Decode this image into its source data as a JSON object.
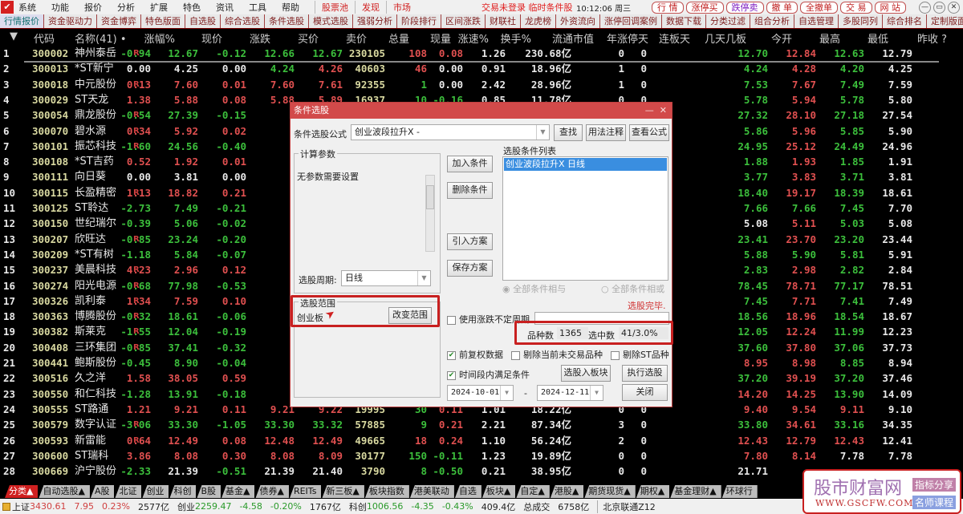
{
  "menu": {
    "items": [
      "系统",
      "功能",
      "报价",
      "分析",
      "扩展",
      "特色",
      "资讯",
      "工具",
      "帮助"
    ],
    "special": [
      "股票池",
      "发现",
      "市场"
    ],
    "status": "交易未登录  临时条件股",
    "clock": "10:12:06 周三",
    "buttons": [
      "行 情",
      "涨停买",
      "跌停卖",
      "撤 单",
      "全撤单",
      "交 易",
      "网 站"
    ],
    "window": [
      "—",
      "▭",
      "✕"
    ]
  },
  "tabs": [
    "行情报价",
    "资金驱动力",
    "资金博弈",
    "特色版面",
    "自选股",
    "综合选股",
    "条件选股",
    "模式选股",
    "强弱分析",
    "阶段排行",
    "区间涨跌",
    "财联社",
    "龙虎榜",
    "外资流向",
    "涨停回调案例",
    "数据下载",
    "分类过滤",
    "组合分析",
    "自选管理",
    "多股同列",
    "综合排名",
    "定制版面"
  ],
  "header": [
    "▼",
    "代码",
    "名称(41)  •",
    "涨幅%",
    "现价",
    "涨跌",
    "买价",
    "卖价",
    "总量",
    "现量",
    "涨速%",
    "换手%",
    "流通市值",
    "年涨停天",
    "连板天",
    "几天几板",
    "今开",
    "最高",
    "最低",
    "昨收 ?"
  ],
  "colors": {
    "up": "#e05050",
    "down": "#3cbf3c",
    "flat": "#e8e8e8",
    "volume": "#d8d8a0"
  },
  "rows": [
    [
      "1",
      "300002",
      "神州泰岳",
      "R",
      "-0.94",
      "12.67",
      "-0.12",
      "12.66",
      "12.67",
      "230105",
      "108",
      "0.08",
      "1.26",
      "230.68亿",
      "0",
      "0",
      "",
      "12.70",
      "12.84",
      "12.63",
      "12.79",
      "up"
    ],
    [
      "2",
      "300013",
      "*ST新宁",
      "",
      "0.00",
      "4.25",
      "0.00",
      "4.24",
      "4.26",
      "40603",
      "46",
      "0.00",
      "0.91",
      "18.96亿",
      "1",
      "0",
      "",
      "4.24",
      "4.28",
      "4.20",
      "4.25",
      "up"
    ],
    [
      "3",
      "300018",
      "中元股份",
      "R",
      "0.13",
      "7.60",
      "0.01",
      "7.60",
      "7.61",
      "92355",
      "1",
      "0.00",
      "2.42",
      "28.96亿",
      "1",
      "0",
      "",
      "7.53",
      "7.67",
      "7.49",
      "7.59",
      "down"
    ],
    [
      "4",
      "300029",
      "ST天龙",
      "",
      "1.38",
      "5.88",
      "0.08",
      "5.88",
      "5.89",
      "16937",
      "10",
      "-0.16",
      "0.85",
      "11.78亿",
      "0",
      "0",
      "",
      "5.78",
      "5.94",
      "5.78",
      "5.80",
      "down"
    ],
    [
      "5",
      "300054",
      "鼎龙股份",
      "R",
      "-0.54",
      "27.39",
      "-0.15",
      "",
      "",
      "",
      "",
      "",
      "",
      "",
      "",
      "",
      "",
      "27.32",
      "28.10",
      "27.18",
      "27.54",
      ""
    ],
    [
      "6",
      "300070",
      "碧水源",
      "R",
      "0.34",
      "5.92",
      "0.02",
      "",
      "",
      "",
      "",
      "",
      "",
      "",
      "",
      "",
      "",
      "5.86",
      "5.96",
      "5.85",
      "5.90",
      ""
    ],
    [
      "7",
      "300101",
      "振芯科技",
      "R",
      "-1.60",
      "24.56",
      "-0.40",
      "",
      "",
      "",
      "",
      "",
      "",
      "",
      "",
      "",
      "",
      "24.95",
      "25.12",
      "24.49",
      "24.96",
      ""
    ],
    [
      "8",
      "300108",
      "*ST吉药",
      "",
      "0.52",
      "1.92",
      "0.01",
      "",
      "",
      "",
      "",
      "",
      "",
      "",
      "",
      "",
      "",
      "1.88",
      "1.93",
      "1.85",
      "1.91",
      ""
    ],
    [
      "9",
      "300111",
      "向日葵",
      "",
      "0.00",
      "3.81",
      "0.00",
      "",
      "",
      "",
      "",
      "",
      "",
      "",
      "",
      "",
      "",
      "3.77",
      "3.83",
      "3.71",
      "3.81",
      ""
    ],
    [
      "10",
      "300115",
      "长盈精密",
      "R",
      "1.13",
      "18.82",
      "0.21",
      "",
      "",
      "",
      "",
      "",
      "",
      "",
      "",
      "",
      "",
      "18.40",
      "19.17",
      "18.39",
      "18.61",
      ""
    ],
    [
      "11",
      "300125",
      "ST聆达",
      "",
      "-2.73",
      "7.49",
      "-0.21",
      "",
      "",
      "",
      "",
      "",
      "",
      "",
      "",
      "",
      "",
      "7.66",
      "7.66",
      "7.45",
      "7.70",
      ""
    ],
    [
      "12",
      "300150",
      "世纪瑞尔",
      "",
      "-0.39",
      "5.06",
      "-0.02",
      "",
      "",
      "",
      "",
      "",
      "",
      "",
      "",
      "",
      "",
      "5.08",
      "5.11",
      "5.03",
      "5.08",
      ""
    ],
    [
      "13",
      "300207",
      "欣旺达",
      "R",
      "-0.85",
      "23.24",
      "-0.20",
      "",
      "",
      "",
      "",
      "",
      "",
      "",
      "",
      "",
      "",
      "23.41",
      "23.70",
      "23.20",
      "23.44",
      ""
    ],
    [
      "14",
      "300209",
      "*ST有树",
      "",
      "-1.18",
      "5.84",
      "-0.07",
      "",
      "",
      "",
      "",
      "",
      "",
      "",
      "",
      "",
      "",
      "5.88",
      "5.90",
      "5.81",
      "5.91",
      ""
    ],
    [
      "15",
      "300237",
      "美晨科技",
      "R",
      "4.23",
      "2.96",
      "0.12",
      "",
      "",
      "",
      "",
      "",
      "",
      "",
      "",
      "",
      "",
      "2.83",
      "2.98",
      "2.82",
      "2.84",
      ""
    ],
    [
      "16",
      "300274",
      "阳光电源",
      "R",
      "-0.68",
      "77.98",
      "-0.53",
      "",
      "",
      "",
      "",
      "",
      "",
      "",
      "",
      "",
      "",
      "78.45",
      "78.71",
      "77.17",
      "78.51",
      ""
    ],
    [
      "17",
      "300326",
      "凯利泰",
      "R",
      "1.34",
      "7.59",
      "0.10",
      "",
      "",
      "",
      "",
      "",
      "",
      "",
      "",
      "",
      "",
      "7.45",
      "7.71",
      "7.41",
      "7.49",
      ""
    ],
    [
      "18",
      "300363",
      "博腾股份",
      "R",
      "-0.32",
      "18.61",
      "-0.06",
      "",
      "",
      "",
      "",
      "",
      "",
      "",
      "",
      "",
      "",
      "18.56",
      "18.96",
      "18.54",
      "18.67",
      ""
    ],
    [
      "19",
      "300382",
      "斯莱克",
      "R",
      "-1.55",
      "12.04",
      "-0.19",
      "",
      "",
      "",
      "",
      "",
      "",
      "",
      "",
      "",
      "",
      "12.05",
      "12.24",
      "11.99",
      "12.23",
      ""
    ],
    [
      "20",
      "300408",
      "三环集团",
      "R",
      "-0.85",
      "37.41",
      "-0.32",
      "",
      "",
      "",
      "",
      "",
      "",
      "",
      "",
      "",
      "",
      "37.60",
      "37.80",
      "37.06",
      "37.73",
      ""
    ],
    [
      "21",
      "300441",
      "鲍斯股份",
      "",
      "-0.45",
      "8.90",
      "-0.04",
      "",
      "",
      "",
      "",
      "",
      "",
      "",
      "",
      "",
      "",
      "8.95",
      "8.98",
      "8.85",
      "8.94",
      ""
    ],
    [
      "22",
      "300516",
      "久之洋",
      "",
      "1.58",
      "38.05",
      "0.59",
      "",
      "",
      "",
      "",
      "",
      "",
      "",
      "",
      "",
      "",
      "37.20",
      "39.19",
      "37.20",
      "37.46",
      ""
    ],
    [
      "23",
      "300550",
      "和仁科技",
      "",
      "-1.28",
      "13.91",
      "-0.18",
      "",
      "",
      "",
      "",
      "",
      "",
      "",
      "",
      "",
      "",
      "14.20",
      "14.25",
      "13.90",
      "14.09",
      ""
    ],
    [
      "24",
      "300555",
      "ST路通",
      "",
      "1.21",
      "9.21",
      "0.11",
      "9.21",
      "9.22",
      "19995",
      "30",
      "0.11",
      "1.01",
      "18.22亿",
      "0",
      "0",
      "",
      "9.40",
      "9.54",
      "9.11",
      "9.10",
      "down"
    ],
    [
      "25",
      "300579",
      "数字认证",
      "R",
      "-3.06",
      "33.30",
      "-1.05",
      "33.30",
      "33.32",
      "57885",
      "9",
      "0.21",
      "2.21",
      "87.34亿",
      "3",
      "0",
      "",
      "33.80",
      "34.61",
      "33.16",
      "34.35",
      "down"
    ],
    [
      "26",
      "300593",
      "新雷能",
      "R",
      "0.64",
      "12.49",
      "0.08",
      "12.48",
      "12.49",
      "49665",
      "18",
      "0.24",
      "1.10",
      "56.24亿",
      "2",
      "0",
      "",
      "12.43",
      "12.79",
      "12.43",
      "12.41",
      "up"
    ],
    [
      "27",
      "300600",
      "ST瑞科",
      "",
      "3.86",
      "8.08",
      "0.30",
      "8.08",
      "8.09",
      "30177",
      "150",
      "-0.11",
      "1.23",
      "19.89亿",
      "0",
      "0",
      "",
      "7.80",
      "8.14",
      "7.78",
      "7.78",
      "down"
    ],
    [
      "28",
      "300669",
      "沪宁股份",
      "",
      "-2.33",
      "21.39",
      "-0.51",
      "21.39",
      "21.40",
      "3790",
      "8",
      "-0.50",
      "0.21",
      "38.95亿",
      "0",
      "0",
      "",
      "21.71",
      "",
      "",
      "",
      "down"
    ]
  ],
  "dialog": {
    "title": "条件选股",
    "formula_label": "条件选股公式",
    "formula_value": "创业波段拉升X  -",
    "find": "查找",
    "usage": "用法注释",
    "view_formula": "查看公式",
    "params_group": "计算参数",
    "params_text": "无参数需要设置",
    "add": "加入条件",
    "delete": "删除条件",
    "import": "引入方案",
    "save": "保存方案",
    "cond_list_label": "选股条件列表",
    "cond_items": [
      "创业波段拉升X  日线"
    ],
    "radio_and": "全部条件相与",
    "radio_or": "全部条件相或",
    "period_label": "选股周期:",
    "period_value": "日线",
    "range_group": "选股范围",
    "range_value": "创业板",
    "change_range": "改变范围",
    "done": "选股完毕.",
    "use_period": "使用涨跌不定周期",
    "count_label": "品种数",
    "count_value": "1365",
    "selected_label": "选中数",
    "selected_value": "41/3.0%",
    "fq": "前复权数据",
    "excl_notrade": "剔除当前未交易品种",
    "excl_st": "剔除ST品种",
    "in_period": "时间段内满足条件",
    "to_block": "选股入板块",
    "run": "执行选股",
    "date_from": "2024-10-01",
    "date_sep": "-",
    "date_to": "2024-12-11",
    "close": "关闭"
  },
  "bottom_tabs": [
    "分类▲",
    "自动选股▲",
    "A股",
    "北证",
    "创业",
    "科创",
    "B股",
    "基金▲",
    "债券▲",
    "REITs",
    "新三板▲",
    "板块指数",
    "港美联动",
    "自选",
    "板块▲",
    "自定▲",
    "港股▲",
    "期货现货▲",
    "期权▲",
    "基金理财▲",
    "环球行"
  ],
  "statusbar": {
    "sh_label": "上证",
    "sh": "3430.61",
    "sh_chg": "7.95",
    "sh_pct": "0.23%",
    "sh_amt": "2577亿",
    "cy_label": "创业",
    "cy": "2259.47",
    "cy_chg": "-4.58",
    "cy_pct": "-0.20%",
    "cy_amt": "1767亿",
    "kc_label": "科创",
    "kc": "1006.56",
    "kc_chg": "-4.35",
    "kc_pct": "-0.43%",
    "kc_amt": "409.4亿",
    "total_label": "总成交",
    "total": "6758亿",
    "conn": "北京联通Z12"
  },
  "watermark": {
    "title": "股市财富网",
    "url": "WWW.GSCFW.COM",
    "tag1": "指标分享",
    "tag2": "名师课程"
  }
}
